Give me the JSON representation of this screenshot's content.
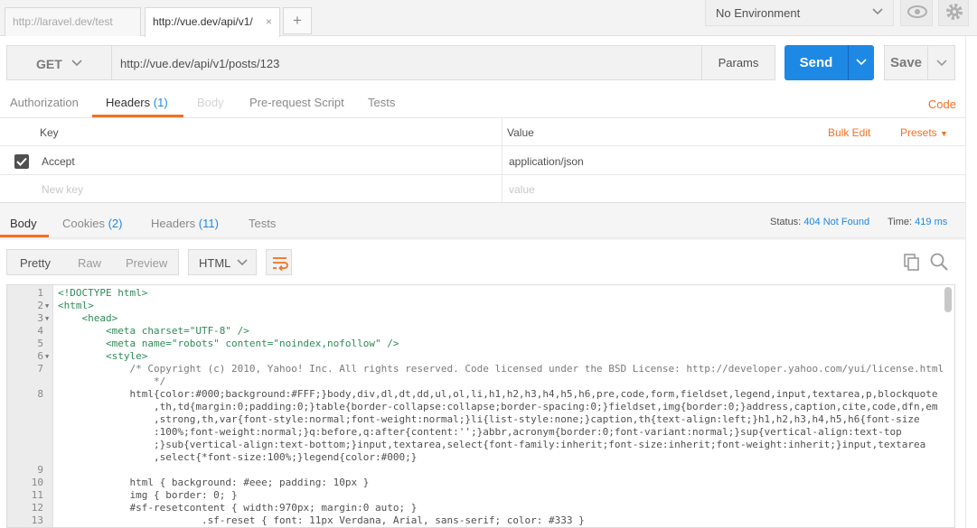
{
  "tabs": [
    {
      "label": "http://laravel.dev/test",
      "active": false
    },
    {
      "label": "http://vue.dev/api/v1/",
      "active": true,
      "close": "×"
    }
  ],
  "new_tab": "+",
  "environment": {
    "selected": "No Environment"
  },
  "request": {
    "method": "GET",
    "url": "http://vue.dev/api/v1/posts/123",
    "params_label": "Params",
    "send_label": "Send",
    "save_label": "Save"
  },
  "request_tabs": {
    "authorization": "Authorization",
    "headers": "Headers",
    "headers_count": "(1)",
    "body": "Body",
    "prerequest": "Pre-request Script",
    "tests": "Tests",
    "code": "Code"
  },
  "headers_table": {
    "key_col": "Key",
    "value_col": "Value",
    "bulk_edit": "Bulk Edit",
    "presets": "Presets",
    "rows": [
      {
        "key": "Accept",
        "value": "application/json",
        "checked": true
      }
    ],
    "new_key_placeholder": "New key",
    "new_value_placeholder": "value"
  },
  "response_tabs": {
    "body": "Body",
    "cookies": "Cookies",
    "cookies_count": "(2)",
    "headers": "Headers",
    "headers_count": "(11)",
    "tests": "Tests"
  },
  "status": {
    "label": "Status:",
    "value": "404 Not Found",
    "time_label": "Time:",
    "time_value": "419 ms"
  },
  "view": {
    "pretty": "Pretty",
    "raw": "Raw",
    "preview": "Preview",
    "language": "HTML"
  },
  "code_lines": [
    {
      "n": "1",
      "text": "<!DOCTYPE html>"
    },
    {
      "n": "2",
      "text": "<html>"
    },
    {
      "n": "3",
      "text": "    <head>"
    },
    {
      "n": "4",
      "text": "        <meta charset=\"UTF-8\" />"
    },
    {
      "n": "5",
      "text": "        <meta name=\"robots\" content=\"noindex,nofollow\" />"
    },
    {
      "n": "6",
      "text": "        <style>"
    },
    {
      "n": "7",
      "text": "            /* Copyright (c) 2010, Yahoo! Inc. All rights reserved. Code licensed under the BSD License: http://developer.yahoo.com/yui/license.html"
    },
    {
      "n": "",
      "text": "                */"
    },
    {
      "n": "8",
      "text": "            html{color:#000;background:#FFF;}body,div,dl,dt,dd,ul,ol,li,h1,h2,h3,h4,h5,h6,pre,code,form,fieldset,legend,input,textarea,p,blockquote"
    },
    {
      "n": "",
      "text": "                ,th,td{margin:0;padding:0;}table{border-collapse:collapse;border-spacing:0;}fieldset,img{border:0;}address,caption,cite,code,dfn,em"
    },
    {
      "n": "",
      "text": "                ,strong,th,var{font-style:normal;font-weight:normal;}li{list-style:none;}caption,th{text-align:left;}h1,h2,h3,h4,h5,h6{font-size"
    },
    {
      "n": "",
      "text": "                :100%;font-weight:normal;}q:before,q:after{content:'';}abbr,acronym{border:0;font-variant:normal;}sup{vertical-align:text-top"
    },
    {
      "n": "",
      "text": "                ;}sub{vertical-align:text-bottom;}input,textarea,select{font-family:inherit;font-size:inherit;font-weight:inherit;}input,textarea"
    },
    {
      "n": "",
      "text": "                ,select{*font-size:100%;}legend{color:#000;}"
    },
    {
      "n": "9",
      "text": ""
    },
    {
      "n": "10",
      "text": "            html { background: #eee; padding: 10px }"
    },
    {
      "n": "11",
      "text": "            img { border: 0; }"
    },
    {
      "n": "12",
      "text": "            #sf-resetcontent { width:970px; margin:0 auto; }"
    },
    {
      "n": "13",
      "text": "                        .sf-reset { font: 11px Verdana, Arial, sans-serif; color: #333 }"
    }
  ],
  "fold_markers": {
    "2": "▼",
    "3": "▼",
    "6": "▼"
  },
  "colors": {
    "accent": "#f47023",
    "send": "#1e88e5",
    "link": "#1e88e5"
  }
}
